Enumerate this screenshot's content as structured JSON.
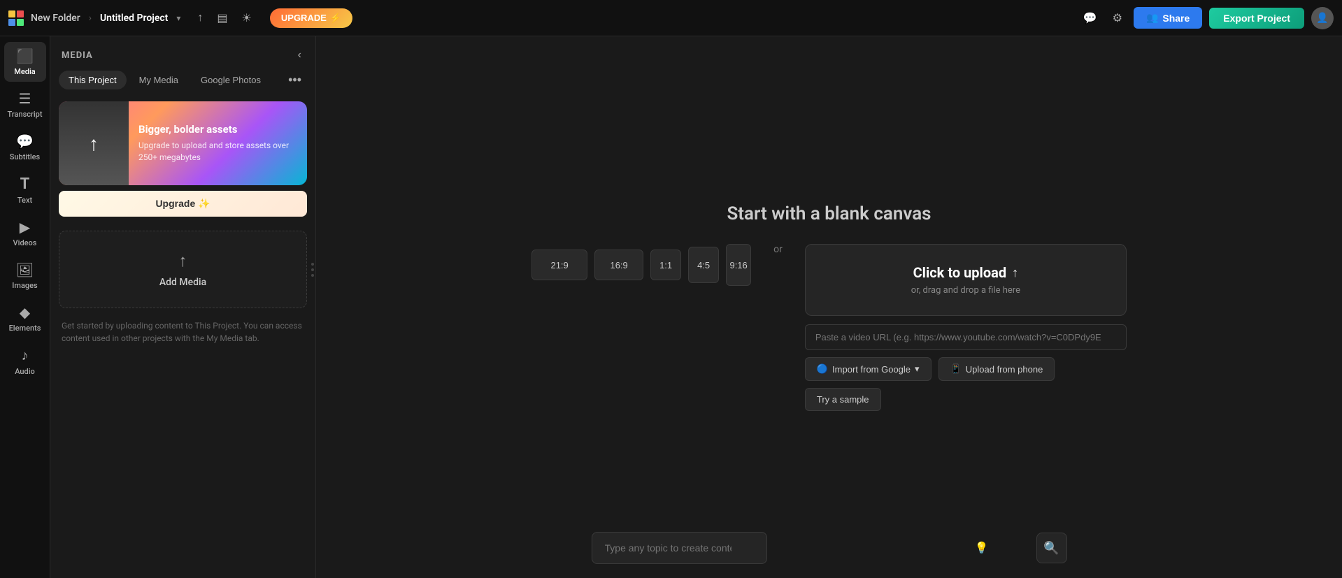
{
  "topbar": {
    "folder_name": "New Folder",
    "separator": "›",
    "project_name": "Untitled Project",
    "upgrade_label": "UPGRADE",
    "upgrade_icon": "⚡",
    "share_label": "Share",
    "export_label": "Export Project"
  },
  "sidebar": {
    "items": [
      {
        "id": "media",
        "label": "Media",
        "icon": "⬛"
      },
      {
        "id": "transcript",
        "label": "Transcript",
        "icon": "☰"
      },
      {
        "id": "subtitles",
        "label": "Subtitles",
        "icon": "💬"
      },
      {
        "id": "text",
        "label": "Text",
        "icon": "T"
      },
      {
        "id": "videos",
        "label": "Videos",
        "icon": "▶"
      },
      {
        "id": "images",
        "label": "Images",
        "icon": "🖼"
      },
      {
        "id": "elements",
        "label": "Elements",
        "icon": "◆"
      },
      {
        "id": "audio",
        "label": "Audio",
        "icon": "♪"
      }
    ]
  },
  "media_panel": {
    "title": "MEDIA",
    "tabs": [
      {
        "id": "this-project",
        "label": "This Project",
        "active": true
      },
      {
        "id": "my-media",
        "label": "My Media",
        "active": false
      },
      {
        "id": "google-photos",
        "label": "Google Photos",
        "active": false
      }
    ],
    "upgrade_card": {
      "title": "Bigger, bolder assets",
      "description": "Upgrade to upload and store assets over 250+ megabytes",
      "cta": "Upgrade ✨"
    },
    "add_media_label": "Add Media",
    "help_text": "Get started by uploading content to This Project. You can access content used in other projects with the My Media tab."
  },
  "canvas": {
    "blank_canvas_title": "Start with a blank canvas",
    "or_text": "or",
    "aspect_ratios": [
      "21:9",
      "16:9",
      "1:1",
      "4:5",
      "9:16"
    ],
    "upload_box": {
      "title": "Click to upload",
      "subtitle": "or, drag and drop a file here",
      "url_placeholder": "Paste a video URL (e.g. https://www.youtube.com/watch?v=C0DPdy9E"
    },
    "import_buttons": [
      {
        "id": "import-google",
        "label": "Import from Google",
        "icon": "▼"
      },
      {
        "id": "upload-phone",
        "label": "Upload from phone",
        "icon": "📱"
      },
      {
        "id": "try-sample",
        "label": "Try a sample"
      }
    ]
  },
  "ai_bar": {
    "placeholder": "Type any topic to create content with Kapwing AI"
  },
  "icons": {
    "collapse": "‹",
    "more": "•••",
    "settings": "⚙",
    "comment": "💬",
    "upload_arrow": "↑",
    "chevron": "▾",
    "phone": "📱",
    "lightbulb": "💡",
    "search": "🔍"
  }
}
